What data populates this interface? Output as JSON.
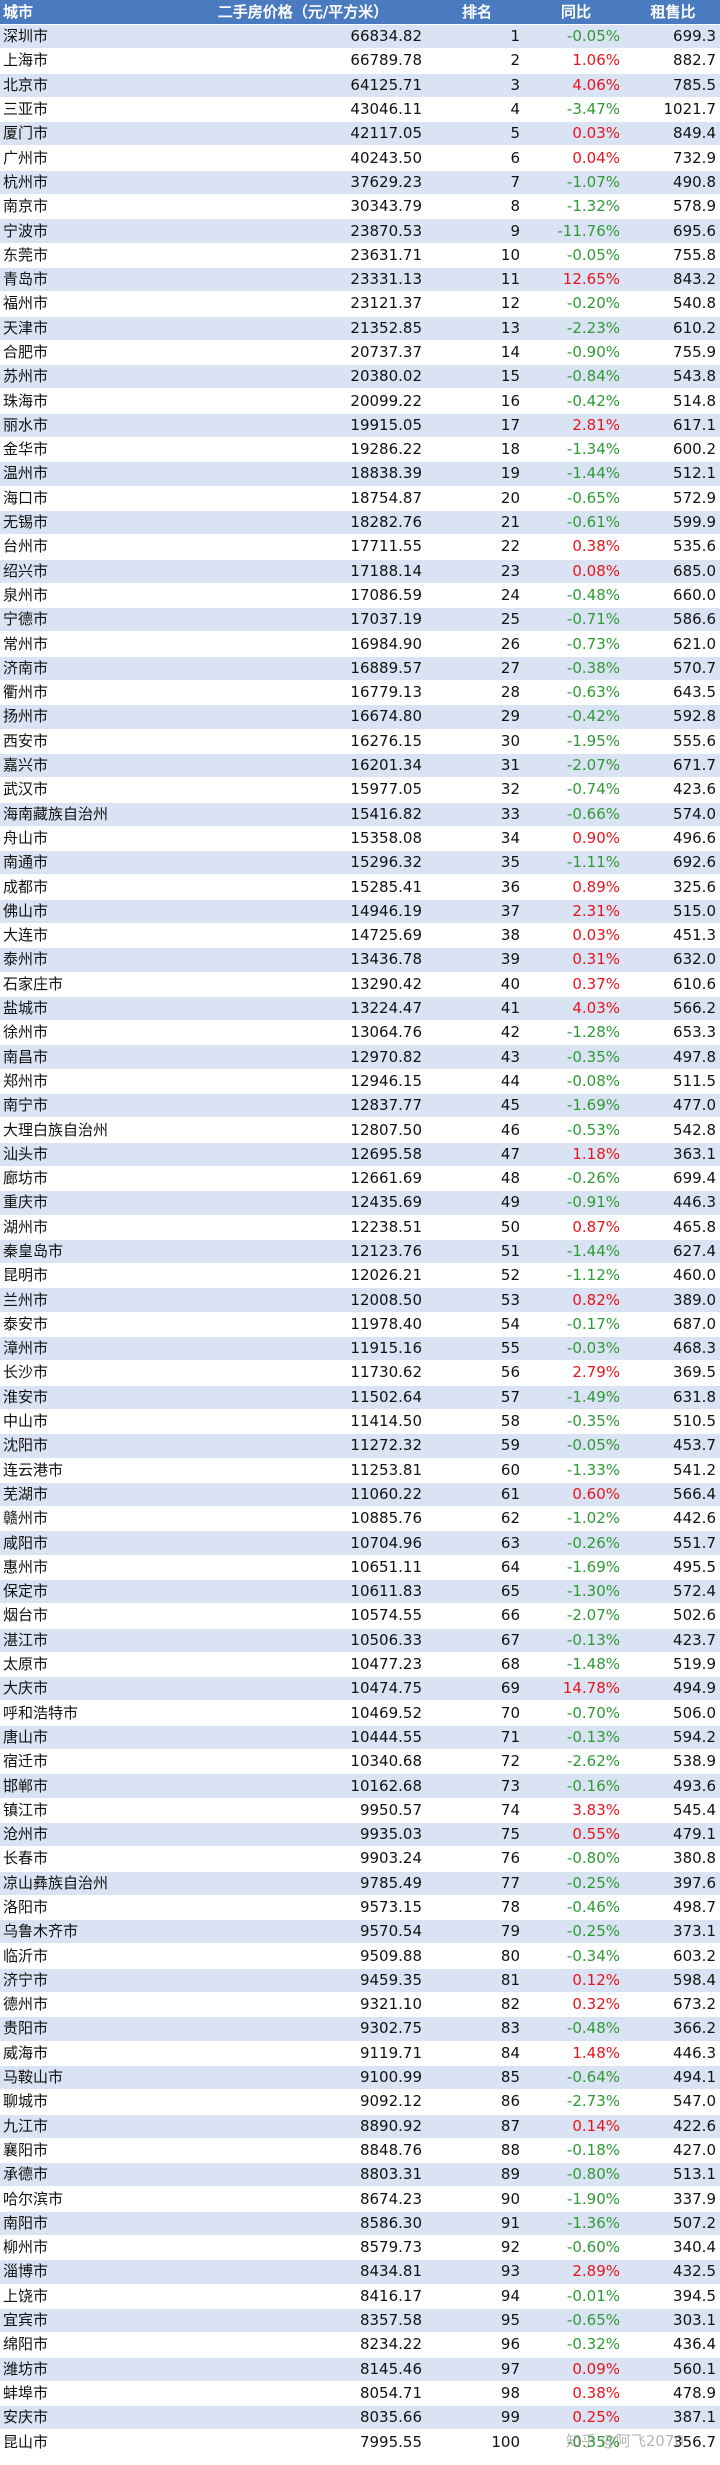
{
  "headers": {
    "city": "城市",
    "price": "二手房价格（元/平方米）",
    "rank": "排名",
    "yoy": "同比",
    "ratio": "租售比"
  },
  "rows": [
    {
      "city": "深圳市",
      "price": "66834.82",
      "rank": "1",
      "yoy": "-0.05%",
      "ratio": "699.3"
    },
    {
      "city": "上海市",
      "price": "66789.78",
      "rank": "2",
      "yoy": "1.06%",
      "ratio": "882.7"
    },
    {
      "city": "北京市",
      "price": "64125.71",
      "rank": "3",
      "yoy": "4.06%",
      "ratio": "785.5"
    },
    {
      "city": "三亚市",
      "price": "43046.11",
      "rank": "4",
      "yoy": "-3.47%",
      "ratio": "1021.7"
    },
    {
      "city": "厦门市",
      "price": "42117.05",
      "rank": "5",
      "yoy": "0.03%",
      "ratio": "849.4"
    },
    {
      "city": "广州市",
      "price": "40243.50",
      "rank": "6",
      "yoy": "0.04%",
      "ratio": "732.9"
    },
    {
      "city": "杭州市",
      "price": "37629.23",
      "rank": "7",
      "yoy": "-1.07%",
      "ratio": "490.8"
    },
    {
      "city": "南京市",
      "price": "30343.79",
      "rank": "8",
      "yoy": "-1.32%",
      "ratio": "578.9"
    },
    {
      "city": "宁波市",
      "price": "23870.53",
      "rank": "9",
      "yoy": "-11.76%",
      "ratio": "695.6"
    },
    {
      "city": "东莞市",
      "price": "23631.71",
      "rank": "10",
      "yoy": "-0.05%",
      "ratio": "755.8"
    },
    {
      "city": "青岛市",
      "price": "23331.13",
      "rank": "11",
      "yoy": "12.65%",
      "ratio": "843.2"
    },
    {
      "city": "福州市",
      "price": "23121.37",
      "rank": "12",
      "yoy": "-0.20%",
      "ratio": "540.8"
    },
    {
      "city": "天津市",
      "price": "21352.85",
      "rank": "13",
      "yoy": "-2.23%",
      "ratio": "610.2"
    },
    {
      "city": "合肥市",
      "price": "20737.37",
      "rank": "14",
      "yoy": "-0.90%",
      "ratio": "755.9"
    },
    {
      "city": "苏州市",
      "price": "20380.02",
      "rank": "15",
      "yoy": "-0.84%",
      "ratio": "543.8"
    },
    {
      "city": "珠海市",
      "price": "20099.22",
      "rank": "16",
      "yoy": "-0.42%",
      "ratio": "514.8"
    },
    {
      "city": "丽水市",
      "price": "19915.05",
      "rank": "17",
      "yoy": "2.81%",
      "ratio": "617.1"
    },
    {
      "city": "金华市",
      "price": "19286.22",
      "rank": "18",
      "yoy": "-1.34%",
      "ratio": "600.2"
    },
    {
      "city": "温州市",
      "price": "18838.39",
      "rank": "19",
      "yoy": "-1.44%",
      "ratio": "512.1"
    },
    {
      "city": "海口市",
      "price": "18754.87",
      "rank": "20",
      "yoy": "-0.65%",
      "ratio": "572.9"
    },
    {
      "city": "无锡市",
      "price": "18282.76",
      "rank": "21",
      "yoy": "-0.61%",
      "ratio": "599.9"
    },
    {
      "city": "台州市",
      "price": "17711.55",
      "rank": "22",
      "yoy": "0.38%",
      "ratio": "535.6"
    },
    {
      "city": "绍兴市",
      "price": "17188.14",
      "rank": "23",
      "yoy": "0.08%",
      "ratio": "685.0"
    },
    {
      "city": "泉州市",
      "price": "17086.59",
      "rank": "24",
      "yoy": "-0.48%",
      "ratio": "660.0"
    },
    {
      "city": "宁德市",
      "price": "17037.19",
      "rank": "25",
      "yoy": "-0.71%",
      "ratio": "586.6"
    },
    {
      "city": "常州市",
      "price": "16984.90",
      "rank": "26",
      "yoy": "-0.73%",
      "ratio": "621.0"
    },
    {
      "city": "济南市",
      "price": "16889.57",
      "rank": "27",
      "yoy": "-0.38%",
      "ratio": "570.7"
    },
    {
      "city": "衢州市",
      "price": "16779.13",
      "rank": "28",
      "yoy": "-0.63%",
      "ratio": "643.5"
    },
    {
      "city": "扬州市",
      "price": "16674.80",
      "rank": "29",
      "yoy": "-0.42%",
      "ratio": "592.8"
    },
    {
      "city": "西安市",
      "price": "16276.15",
      "rank": "30",
      "yoy": "-1.95%",
      "ratio": "555.6"
    },
    {
      "city": "嘉兴市",
      "price": "16201.34",
      "rank": "31",
      "yoy": "-2.07%",
      "ratio": "671.7"
    },
    {
      "city": "武汉市",
      "price": "15977.05",
      "rank": "32",
      "yoy": "-0.74%",
      "ratio": "423.6"
    },
    {
      "city": "海南藏族自治州",
      "price": "15416.82",
      "rank": "33",
      "yoy": "-0.66%",
      "ratio": "574.0"
    },
    {
      "city": "舟山市",
      "price": "15358.08",
      "rank": "34",
      "yoy": "0.90%",
      "ratio": "496.6"
    },
    {
      "city": "南通市",
      "price": "15296.32",
      "rank": "35",
      "yoy": "-1.11%",
      "ratio": "692.6"
    },
    {
      "city": "成都市",
      "price": "15285.41",
      "rank": "36",
      "yoy": "0.89%",
      "ratio": "325.6"
    },
    {
      "city": "佛山市",
      "price": "14946.19",
      "rank": "37",
      "yoy": "2.31%",
      "ratio": "515.0"
    },
    {
      "city": "大连市",
      "price": "14725.69",
      "rank": "38",
      "yoy": "0.03%",
      "ratio": "451.3"
    },
    {
      "city": "泰州市",
      "price": "13436.78",
      "rank": "39",
      "yoy": "0.31%",
      "ratio": "632.0"
    },
    {
      "city": "石家庄市",
      "price": "13290.42",
      "rank": "40",
      "yoy": "0.37%",
      "ratio": "610.6"
    },
    {
      "city": "盐城市",
      "price": "13224.47",
      "rank": "41",
      "yoy": "4.03%",
      "ratio": "566.2"
    },
    {
      "city": "徐州市",
      "price": "13064.76",
      "rank": "42",
      "yoy": "-1.28%",
      "ratio": "653.3"
    },
    {
      "city": "南昌市",
      "price": "12970.82",
      "rank": "43",
      "yoy": "-0.35%",
      "ratio": "497.8"
    },
    {
      "city": "郑州市",
      "price": "12946.15",
      "rank": "44",
      "yoy": "-0.08%",
      "ratio": "511.5"
    },
    {
      "city": "南宁市",
      "price": "12837.77",
      "rank": "45",
      "yoy": "-1.69%",
      "ratio": "477.0"
    },
    {
      "city": "大理白族自治州",
      "price": "12807.50",
      "rank": "46",
      "yoy": "-0.53%",
      "ratio": "542.8"
    },
    {
      "city": "汕头市",
      "price": "12695.58",
      "rank": "47",
      "yoy": "1.18%",
      "ratio": "363.1"
    },
    {
      "city": "廊坊市",
      "price": "12661.69",
      "rank": "48",
      "yoy": "-0.26%",
      "ratio": "699.4"
    },
    {
      "city": "重庆市",
      "price": "12435.69",
      "rank": "49",
      "yoy": "-0.91%",
      "ratio": "446.3"
    },
    {
      "city": "湖州市",
      "price": "12238.51",
      "rank": "50",
      "yoy": "0.87%",
      "ratio": "465.8"
    },
    {
      "city": "秦皇岛市",
      "price": "12123.76",
      "rank": "51",
      "yoy": "-1.44%",
      "ratio": "627.4"
    },
    {
      "city": "昆明市",
      "price": "12026.21",
      "rank": "52",
      "yoy": "-1.12%",
      "ratio": "460.0"
    },
    {
      "city": "兰州市",
      "price": "12008.50",
      "rank": "53",
      "yoy": "0.82%",
      "ratio": "389.0"
    },
    {
      "city": "泰安市",
      "price": "11978.40",
      "rank": "54",
      "yoy": "-0.17%",
      "ratio": "687.0"
    },
    {
      "city": "漳州市",
      "price": "11915.16",
      "rank": "55",
      "yoy": "-0.03%",
      "ratio": "468.3"
    },
    {
      "city": "长沙市",
      "price": "11730.62",
      "rank": "56",
      "yoy": "2.79%",
      "ratio": "369.5"
    },
    {
      "city": "淮安市",
      "price": "11502.64",
      "rank": "57",
      "yoy": "-1.49%",
      "ratio": "631.8"
    },
    {
      "city": "中山市",
      "price": "11414.50",
      "rank": "58",
      "yoy": "-0.35%",
      "ratio": "510.5"
    },
    {
      "city": "沈阳市",
      "price": "11272.32",
      "rank": "59",
      "yoy": "-0.05%",
      "ratio": "453.7"
    },
    {
      "city": "连云港市",
      "price": "11253.81",
      "rank": "60",
      "yoy": "-1.33%",
      "ratio": "541.2"
    },
    {
      "city": "芜湖市",
      "price": "11060.22",
      "rank": "61",
      "yoy": "0.60%",
      "ratio": "566.4"
    },
    {
      "city": "赣州市",
      "price": "10885.76",
      "rank": "62",
      "yoy": "-1.02%",
      "ratio": "442.6"
    },
    {
      "city": "咸阳市",
      "price": "10704.96",
      "rank": "63",
      "yoy": "-0.26%",
      "ratio": "551.7"
    },
    {
      "city": "惠州市",
      "price": "10651.11",
      "rank": "64",
      "yoy": "-1.69%",
      "ratio": "495.5"
    },
    {
      "city": "保定市",
      "price": "10611.83",
      "rank": "65",
      "yoy": "-1.30%",
      "ratio": "572.4"
    },
    {
      "city": "烟台市",
      "price": "10574.55",
      "rank": "66",
      "yoy": "-2.07%",
      "ratio": "502.6"
    },
    {
      "city": "湛江市",
      "price": "10506.33",
      "rank": "67",
      "yoy": "-0.13%",
      "ratio": "423.7"
    },
    {
      "city": "太原市",
      "price": "10477.23",
      "rank": "68",
      "yoy": "-1.48%",
      "ratio": "519.9"
    },
    {
      "city": "大庆市",
      "price": "10474.75",
      "rank": "69",
      "yoy": "14.78%",
      "ratio": "494.9"
    },
    {
      "city": "呼和浩特市",
      "price": "10469.52",
      "rank": "70",
      "yoy": "-0.70%",
      "ratio": "506.0"
    },
    {
      "city": "唐山市",
      "price": "10444.55",
      "rank": "71",
      "yoy": "-0.13%",
      "ratio": "594.2"
    },
    {
      "city": "宿迁市",
      "price": "10340.68",
      "rank": "72",
      "yoy": "-2.62%",
      "ratio": "538.9"
    },
    {
      "city": "邯郸市",
      "price": "10162.68",
      "rank": "73",
      "yoy": "-0.16%",
      "ratio": "493.6"
    },
    {
      "city": "镇江市",
      "price": "9950.57",
      "rank": "74",
      "yoy": "3.83%",
      "ratio": "545.4"
    },
    {
      "city": "沧州市",
      "price": "9935.03",
      "rank": "75",
      "yoy": "0.55%",
      "ratio": "479.1"
    },
    {
      "city": "长春市",
      "price": "9903.24",
      "rank": "76",
      "yoy": "-0.80%",
      "ratio": "380.8"
    },
    {
      "city": "凉山彝族自治州",
      "price": "9785.49",
      "rank": "77",
      "yoy": "-0.25%",
      "ratio": "397.6"
    },
    {
      "city": "洛阳市",
      "price": "9573.15",
      "rank": "78",
      "yoy": "-0.46%",
      "ratio": "498.7"
    },
    {
      "city": "乌鲁木齐市",
      "price": "9570.54",
      "rank": "79",
      "yoy": "-0.25%",
      "ratio": "373.1"
    },
    {
      "city": "临沂市",
      "price": "9509.88",
      "rank": "80",
      "yoy": "-0.34%",
      "ratio": "603.2"
    },
    {
      "city": "济宁市",
      "price": "9459.35",
      "rank": "81",
      "yoy": "0.12%",
      "ratio": "598.4"
    },
    {
      "city": "德州市",
      "price": "9321.10",
      "rank": "82",
      "yoy": "0.32%",
      "ratio": "673.2"
    },
    {
      "city": "贵阳市",
      "price": "9302.75",
      "rank": "83",
      "yoy": "-0.48%",
      "ratio": "366.2"
    },
    {
      "city": "威海市",
      "price": "9119.71",
      "rank": "84",
      "yoy": "1.48%",
      "ratio": "446.3"
    },
    {
      "city": "马鞍山市",
      "price": "9100.99",
      "rank": "85",
      "yoy": "-0.64%",
      "ratio": "494.1"
    },
    {
      "city": "聊城市",
      "price": "9092.12",
      "rank": "86",
      "yoy": "-2.73%",
      "ratio": "547.0"
    },
    {
      "city": "九江市",
      "price": "8890.92",
      "rank": "87",
      "yoy": "0.14%",
      "ratio": "422.6"
    },
    {
      "city": "襄阳市",
      "price": "8848.76",
      "rank": "88",
      "yoy": "-0.18%",
      "ratio": "427.0"
    },
    {
      "city": "承德市",
      "price": "8803.31",
      "rank": "89",
      "yoy": "-0.80%",
      "ratio": "513.1"
    },
    {
      "city": "哈尔滨市",
      "price": "8674.23",
      "rank": "90",
      "yoy": "-1.90%",
      "ratio": "337.9"
    },
    {
      "city": "南阳市",
      "price": "8586.30",
      "rank": "91",
      "yoy": "-1.36%",
      "ratio": "507.2"
    },
    {
      "city": "柳州市",
      "price": "8579.73",
      "rank": "92",
      "yoy": "-0.60%",
      "ratio": "340.4"
    },
    {
      "city": "淄博市",
      "price": "8434.81",
      "rank": "93",
      "yoy": "2.89%",
      "ratio": "432.5"
    },
    {
      "city": "上饶市",
      "price": "8416.17",
      "rank": "94",
      "yoy": "-0.01%",
      "ratio": "394.5"
    },
    {
      "city": "宜宾市",
      "price": "8357.58",
      "rank": "95",
      "yoy": "-0.65%",
      "ratio": "303.1"
    },
    {
      "city": "绵阳市",
      "price": "8234.22",
      "rank": "96",
      "yoy": "-0.32%",
      "ratio": "436.4"
    },
    {
      "city": "潍坊市",
      "price": "8145.46",
      "rank": "97",
      "yoy": "0.09%",
      "ratio": "560.1"
    },
    {
      "city": "蚌埠市",
      "price": "8054.71",
      "rank": "98",
      "yoy": "0.38%",
      "ratio": "478.9"
    },
    {
      "city": "安庆市",
      "price": "8035.66",
      "rank": "99",
      "yoy": "0.25%",
      "ratio": "387.1"
    },
    {
      "city": "昆山市",
      "price": "7995.55",
      "rank": "100",
      "yoy": "-0.35%",
      "ratio": "356.7"
    }
  ],
  "colors": {
    "header_bg": "#4a7ac0",
    "stripe": "#dae3f3",
    "positive": "#e8141b",
    "negative": "#2f9a35"
  },
  "watermark": "知乎 @阿飞2070"
}
